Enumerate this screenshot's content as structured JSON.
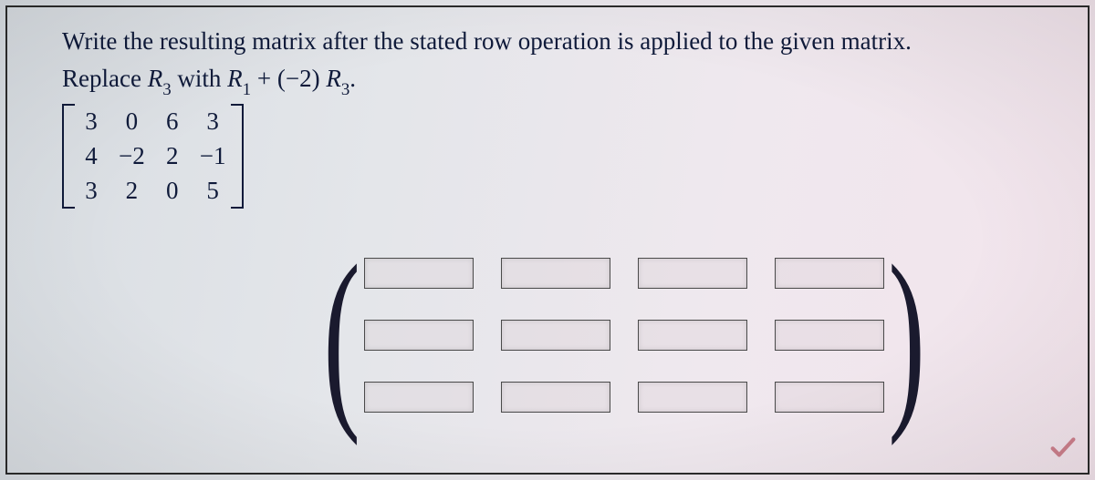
{
  "problem": {
    "instruction": "Write the resulting matrix after the stated row operation is applied to the given matrix.",
    "replace_prefix": "Replace ",
    "target_row": "R",
    "target_row_sub": "3",
    "with_text": "  with ",
    "source_row": "R",
    "source_row_sub": "1",
    "plus_text": " + (−2) ",
    "mult_row": "R",
    "mult_row_sub": "3",
    "period": "."
  },
  "given_matrix": {
    "rows": [
      [
        "3",
        "0",
        "6",
        "3"
      ],
      [
        "4",
        "−2",
        "2",
        "−1"
      ],
      [
        "3",
        "2",
        "0",
        "5"
      ]
    ]
  },
  "answer_matrix": {
    "rows": 3,
    "cols": 4,
    "values": [
      [
        "",
        "",
        "",
        ""
      ],
      [
        "",
        "",
        "",
        ""
      ],
      [
        "",
        "",
        "",
        ""
      ]
    ]
  }
}
